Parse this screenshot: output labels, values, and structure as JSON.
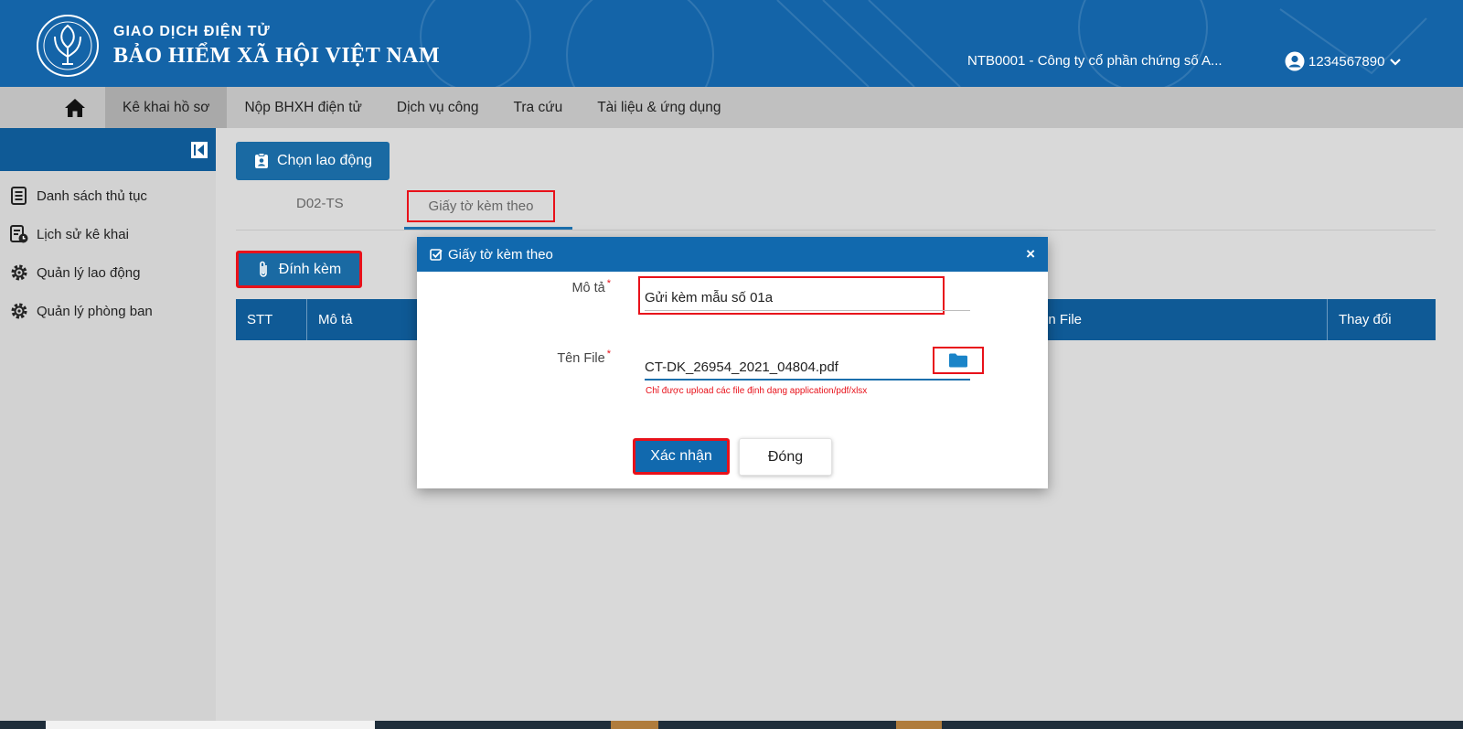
{
  "header": {
    "brand_top": "GIAO DỊCH ĐIỆN TỬ",
    "brand_main": "BẢO HIỂM XÃ HỘI VIỆT NAM",
    "company": "NTB0001 - Công ty cổ phần chứng số A...",
    "user": "1234567890",
    "logo_icon": "vss-logo-icon"
  },
  "nav": {
    "home_icon": "home-icon",
    "items": [
      "Kê khai hồ sơ",
      "Nộp BHXH điện tử",
      "Dịch vụ công",
      "Tra cứu",
      "Tài liệu & ứng dụng"
    ],
    "active": "Kê khai hồ sơ"
  },
  "sidebar": {
    "items": [
      {
        "label": "Danh sách thủ tục",
        "icon": "document-list-icon"
      },
      {
        "label": "Lịch sử kê khai",
        "icon": "history-icon"
      },
      {
        "label": "Quản lý lao động",
        "icon": "gear-icon"
      },
      {
        "label": "Quản lý phòng ban",
        "icon": "gear-icon"
      }
    ]
  },
  "main": {
    "chon_lao_dong": "Chọn lao động",
    "tabs": [
      "D02-TS",
      "Giấy tờ kèm theo"
    ],
    "active_tab": "Giấy tờ kèm theo",
    "dinh_kem": "Đính kèm",
    "table_headers": [
      "STT",
      "Mô tả",
      "ên File",
      "Thay đổi"
    ]
  },
  "modal": {
    "title": "Giấy tờ kèm theo",
    "mota_label": "Mô tả",
    "mota_value": "Gửi kèm mẫu số 01a",
    "tenfile_label": "Tên File",
    "tenfile_value": "CT-DK_26954_2021_04804.pdf",
    "hint": "Chỉ được upload các file định dạng application/pdf/xlsx",
    "confirm": "Xác nhận",
    "close": "Đóng",
    "close_symbol": "×"
  },
  "colors": {
    "primary": "#1464a8",
    "highlight": "#e8111a"
  }
}
